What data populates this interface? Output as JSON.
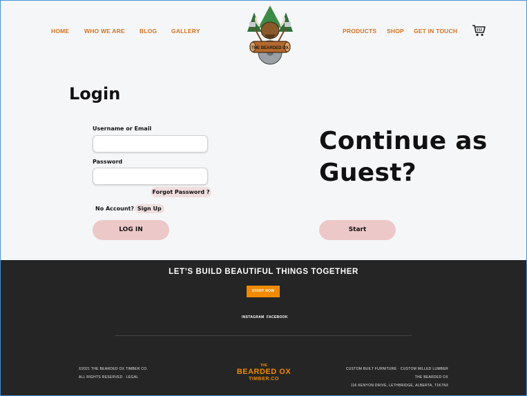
{
  "header": {
    "nav_left": [
      "HOME",
      "WHO WE ARE",
      "BLOG",
      "GALLERY"
    ],
    "nav_right": [
      "PRODUCTS",
      "SHOP",
      "GET IN TOUCH"
    ],
    "logo_text": "THE BEARDED OX",
    "cart_icon": "shopping-cart-icon"
  },
  "login": {
    "title": "Login",
    "username_label": "Username or Email",
    "username_value": "",
    "password_label": "Password",
    "password_value": "",
    "forgot_label": "Forgot Password ?",
    "no_account_label": "No Account?",
    "signup_label": "Sign Up",
    "login_button": "LOG IN"
  },
  "guest": {
    "title_line1": "Continue as",
    "title_line2": "Guest?",
    "start_button": "Start"
  },
  "footer": {
    "tagline": "LET’S BUILD BEAUTIFUL THINGS TOGETHER",
    "start_now": "START NOW",
    "instagram": "INSTAGRAM",
    "facebook": "FACEBOOK",
    "copyright": "©2021 THE BEARDED OX TIMBER CO.",
    "rights": "ALL RIGHTS RESERVED · LEGAL",
    "logo_line1": "THE",
    "logo_line2": "BEARDED OX",
    "logo_line3": "TIMBER.CO",
    "services": "CUSTOM BUILT FURNITURE · CUSTOM MILLED LUMBER",
    "company": "THE BEARDED OX",
    "address": "116 KENYON DRIVE, LETHBRIDGE, ALBERTA, T1K7N3"
  },
  "colors": {
    "nav": "#d3731f",
    "accent_orange": "#f08a00",
    "pill_pink": "#ecc8c8",
    "footer_bg": "#252525",
    "page_bg": "#f5f6f8"
  }
}
